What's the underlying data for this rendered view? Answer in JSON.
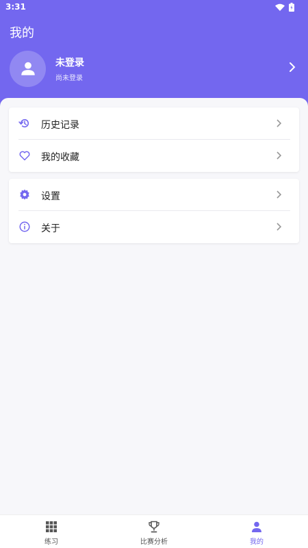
{
  "status_bar": {
    "time": "3:31"
  },
  "header": {
    "title": "我的"
  },
  "profile": {
    "name": "未登录",
    "subtitle": "尚未登录"
  },
  "menu_groups": [
    {
      "items": [
        {
          "label": "历史记录",
          "icon": "history-icon"
        },
        {
          "label": "我的收藏",
          "icon": "heart-icon"
        }
      ]
    },
    {
      "items": [
        {
          "label": "设置",
          "icon": "gear-icon"
        },
        {
          "label": "关于",
          "icon": "info-icon"
        }
      ]
    }
  ],
  "bottom_nav": {
    "items": [
      {
        "label": "练习",
        "icon": "grid-icon"
      },
      {
        "label": "比赛分析",
        "icon": "trophy-icon"
      },
      {
        "label": "我的",
        "icon": "person-icon"
      }
    ],
    "active_index": 2
  },
  "colors": {
    "accent": "#7367ef",
    "background": "#f7f7fa",
    "text": "#222222"
  }
}
